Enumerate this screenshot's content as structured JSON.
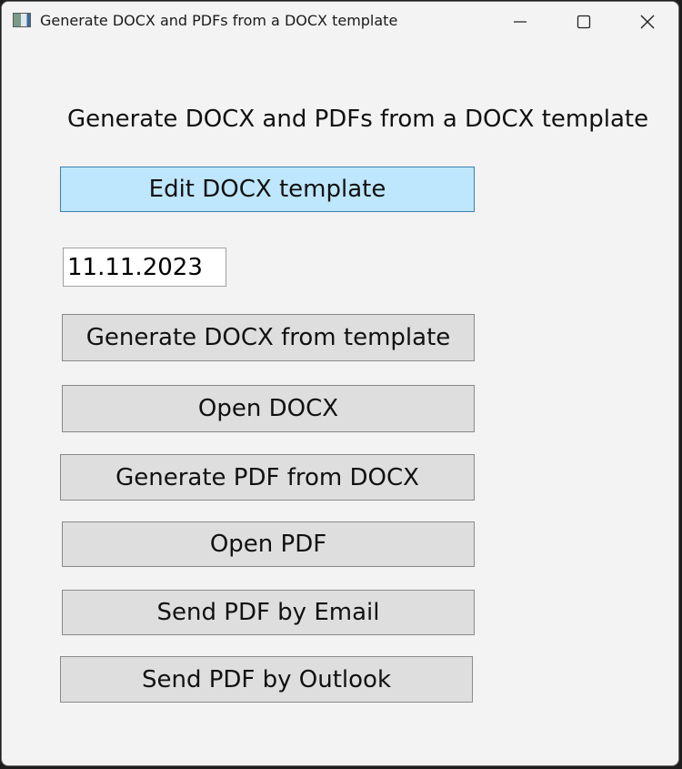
{
  "window": {
    "title": "Generate DOCX and PDFs from a DOCX template",
    "icon": "app-window-icon",
    "controls": [
      "minimize-icon",
      "maximize-icon",
      "close-icon"
    ]
  },
  "main": {
    "heading": "Generate DOCX and PDFs from a DOCX template",
    "edit_template_label": "Edit DOCX template",
    "date_value": "11.11.2023",
    "generate_docx_label": "Generate DOCX from template",
    "open_docx_label": "Open DOCX",
    "generate_pdf_label": "Generate PDF from DOCX",
    "open_pdf_label": "Open PDF",
    "send_email_label": "Send PDF by Email",
    "send_outlook_label": "Send PDF by Outlook"
  },
  "colors": {
    "window_bg": "#f3f3f3",
    "button_bg": "#dedede",
    "button_border": "#8a8a8a",
    "primary_button_bg": "#bee6fd",
    "primary_button_border": "#3c7fb1",
    "desktop_bg": "#1e1e1e"
  }
}
